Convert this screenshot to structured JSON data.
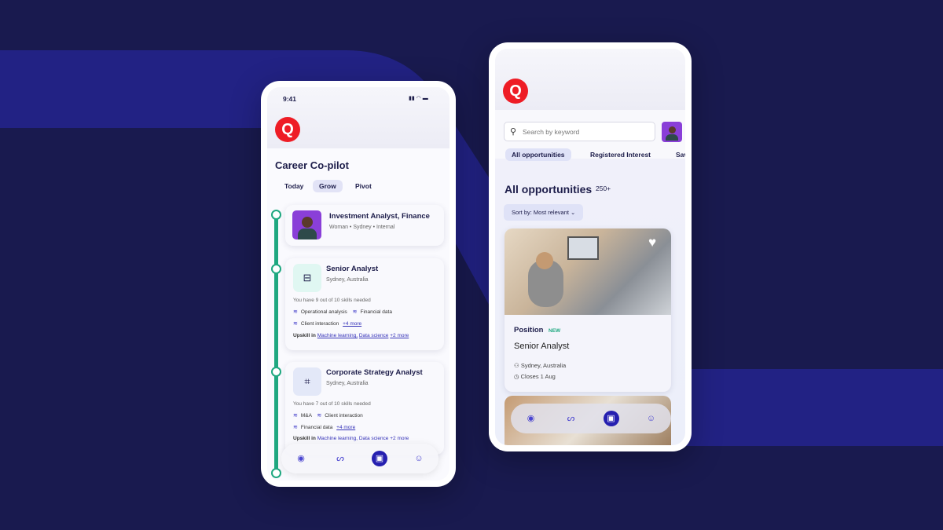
{
  "phone1": {
    "status": {
      "time": "9:41"
    },
    "logo": "Q",
    "title": "Career Co-pilot",
    "tabs": [
      {
        "label": "Today"
      },
      {
        "label": "Grow",
        "active": true
      },
      {
        "label": "Pivot"
      }
    ],
    "profile": {
      "title": "Investment Analyst, Finance",
      "meta": "Woman • Sydney • Internal"
    },
    "roles": [
      {
        "title": "Senior Analyst",
        "location": "Sydney, Australia",
        "skills_note": "You have 9 out of 10 skills needed",
        "skills": [
          "Operational analysis",
          "Financial data",
          "Client interaction"
        ],
        "more": "+4 more",
        "upskill_label": "Upskill in",
        "upskill": [
          "Machine learning,",
          "Data science"
        ],
        "upskill_more": "+2 more",
        "icon": "drive-icon"
      },
      {
        "title": "Corporate Strategy Analyst",
        "location": "Sydney, Australia",
        "skills_note": "You have 7 out of 10 skills needed",
        "skills": [
          "M&A",
          "Client interaction",
          "Financial data"
        ],
        "more": "+4 more",
        "upskill_label": "Upskill in",
        "upskill": [
          "Machine learning,",
          "Data science"
        ],
        "upskill_more": "+2 more",
        "icon": "presentation-chart-icon"
      }
    ]
  },
  "phone2": {
    "logo": "Q",
    "search": {
      "placeholder": "Search by keyword"
    },
    "tabs": [
      {
        "label": "All opportunities",
        "active": true
      },
      {
        "label": "Registered Interest"
      },
      {
        "label": "Sav"
      }
    ],
    "heading": "All opportunities",
    "count": "250+",
    "sort": "Sort by: Most relevant",
    "job": {
      "type": "Position",
      "badge": "NEW",
      "title": "Senior Analyst",
      "location": "Sydney, Australia",
      "closes": "Closes 1 Aug"
    }
  },
  "colors": {
    "accent": "#2620b0",
    "brand": "#ee1c25",
    "timeline": "#1fa880",
    "background": "#191a4f"
  }
}
